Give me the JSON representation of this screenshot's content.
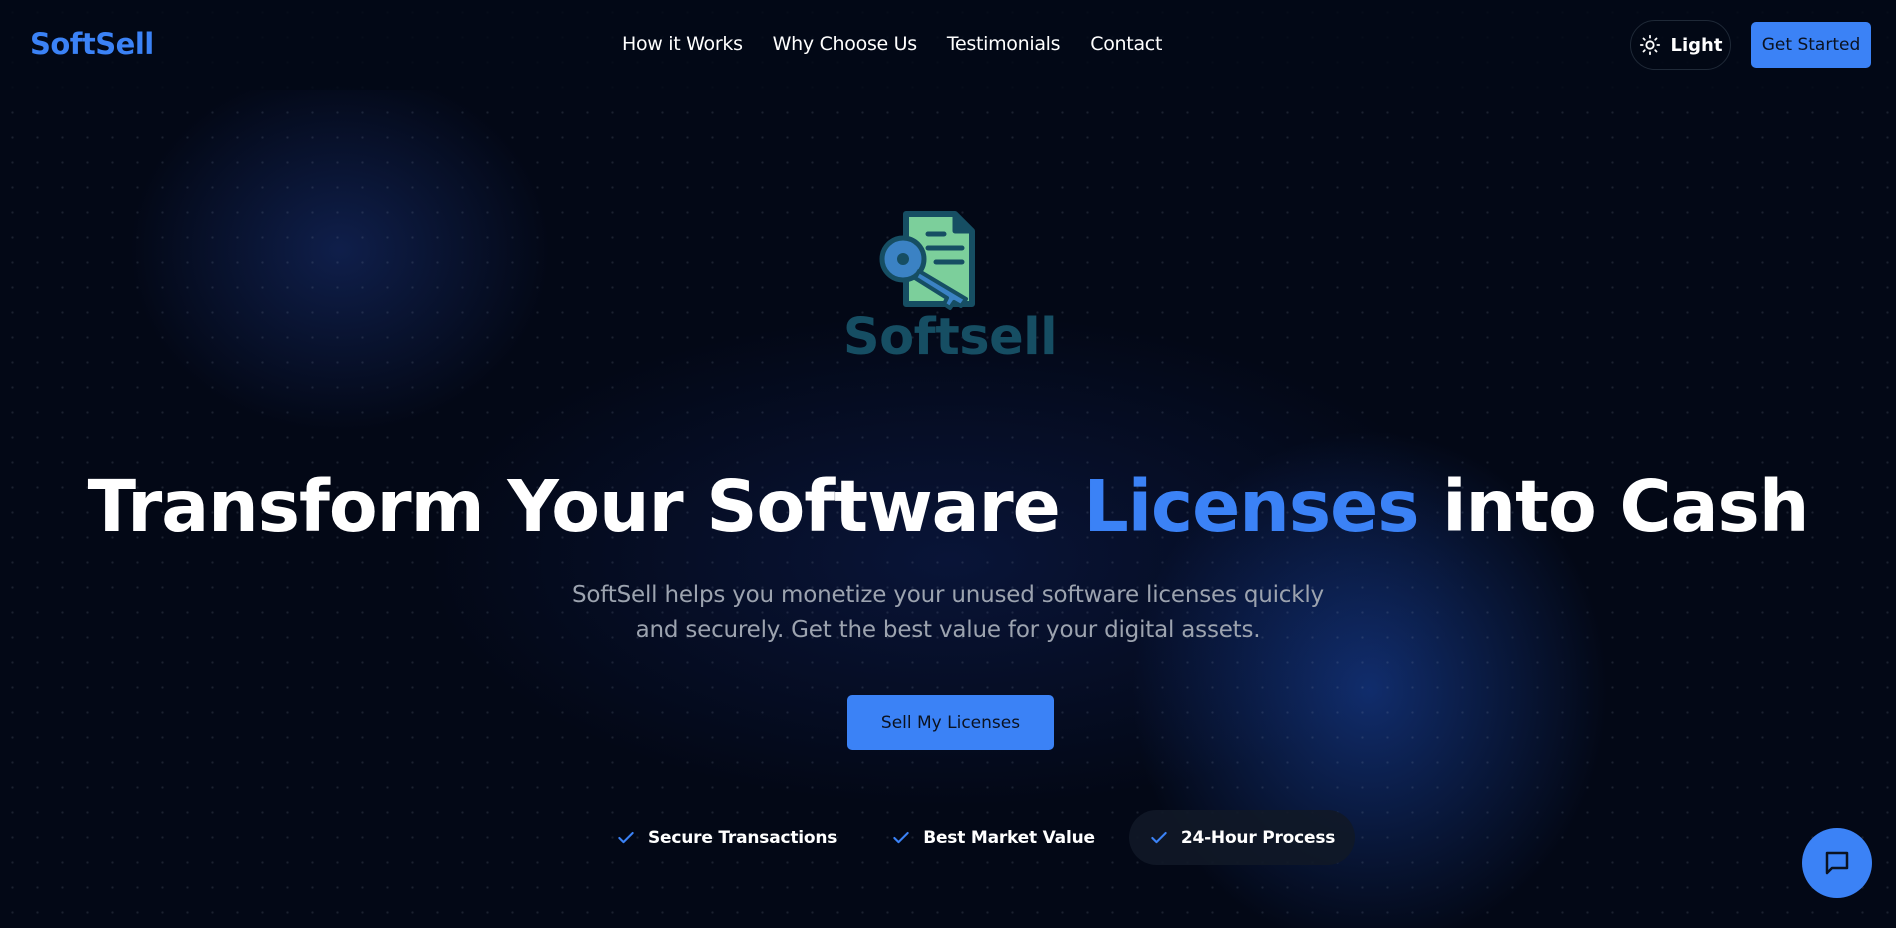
{
  "header": {
    "brand": "SoftSell",
    "nav": [
      "How it Works",
      "Why Choose Us",
      "Testimonials",
      "Contact"
    ],
    "theme_toggle_label": "Light",
    "get_started_label": "Get Started"
  },
  "hero": {
    "logo_text": "Softsell",
    "title_part1": "Transform Your Software ",
    "title_accent": "Licenses",
    "title_part2": " into Cash",
    "subtitle": "SoftSell helps you monetize your unused software licenses quickly and securely. Get the best value for your digital assets.",
    "cta_label": "Sell My Licenses",
    "features": [
      "Secure Transactions",
      "Best Market Value",
      "24-Hour Process"
    ]
  },
  "icons": {
    "theme": "sun-icon",
    "feature": "check-icon",
    "chat": "chat-bubble-icon",
    "logo": "license-key-document-icon"
  },
  "colors": {
    "background": "#030816",
    "accent": "#3b82f6",
    "logo_teal": "#164e63",
    "logo_green": "#7ccf9b",
    "subtitle": "#9ca3af"
  }
}
